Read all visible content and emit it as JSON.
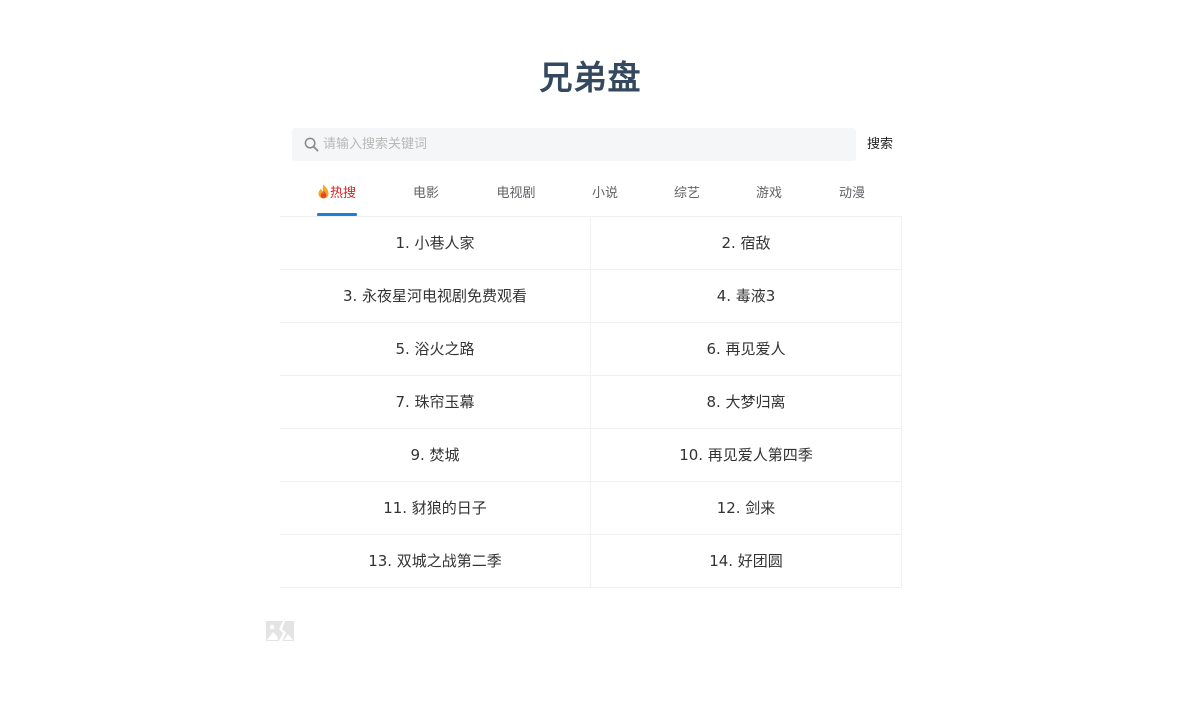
{
  "site": {
    "title": "兄弟盘"
  },
  "search": {
    "placeholder": "请输入搜索关键词",
    "value": "",
    "button_label": "搜索",
    "icon": "search-icon"
  },
  "tabs": [
    {
      "label": "热搜",
      "icon": "fire-icon",
      "active": true
    },
    {
      "label": "电影",
      "active": false
    },
    {
      "label": "电视剧",
      "active": false
    },
    {
      "label": "小说",
      "active": false
    },
    {
      "label": "综艺",
      "active": false
    },
    {
      "label": "游戏",
      "active": false
    },
    {
      "label": "动漫",
      "active": false
    }
  ],
  "hot_list": [
    {
      "text": "1. 小巷人家"
    },
    {
      "text": "2. 宿敌"
    },
    {
      "text": "3. 永夜星河电视剧免费观看"
    },
    {
      "text": "4. 毒液3"
    },
    {
      "text": "5. 浴火之路"
    },
    {
      "text": "6. 再见爱人"
    },
    {
      "text": "7. 珠帘玉幕"
    },
    {
      "text": "8. 大梦归离"
    },
    {
      "text": "9. 焚城"
    },
    {
      "text": "10. 再见爱人第四季"
    },
    {
      "text": "11. 豺狼的日子"
    },
    {
      "text": "12. 剑来"
    },
    {
      "text": "13. 双城之战第二季"
    },
    {
      "text": "14. 好团圆"
    }
  ],
  "colors": {
    "title": "#35495e",
    "active_tab": "#e02020",
    "tab_underline": "#1e7fd6",
    "search_bg": "#f5f6f7"
  },
  "footer": {
    "image_icon": "broken-image-icon"
  }
}
